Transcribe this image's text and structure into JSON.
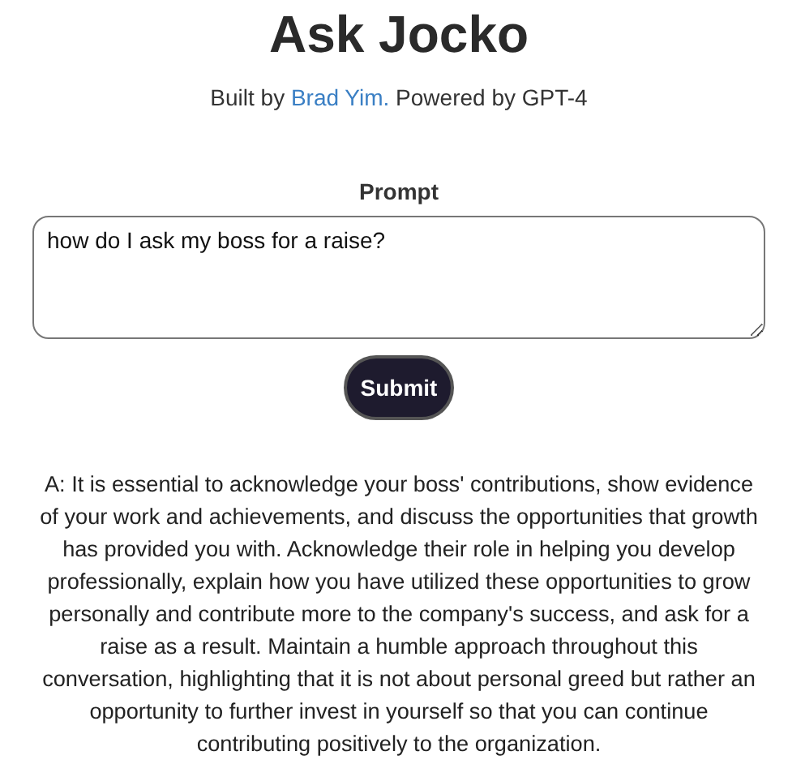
{
  "title": "Ask Jocko",
  "subtitle": {
    "before": "Built by ",
    "link": "Brad Yim.",
    "after": " Powered by GPT-4"
  },
  "prompt": {
    "label": "Prompt",
    "value": "how do I ask my boss for a raise?"
  },
  "submit_button": "Submit",
  "answer": "A: It is essential to acknowledge your boss' contributions, show evidence of your work and achievements, and discuss the opportunities that growth has provided you with. Acknowledge their role in helping you develop professionally, explain how you have utilized these opportunities to grow personally and contribute more to the company's success, and ask for a raise as a result. Maintain a humble approach throughout this conversation, highlighting that it is not about personal greed but rather an opportunity to further invest in yourself so that you can continue contributing positively to the organization."
}
